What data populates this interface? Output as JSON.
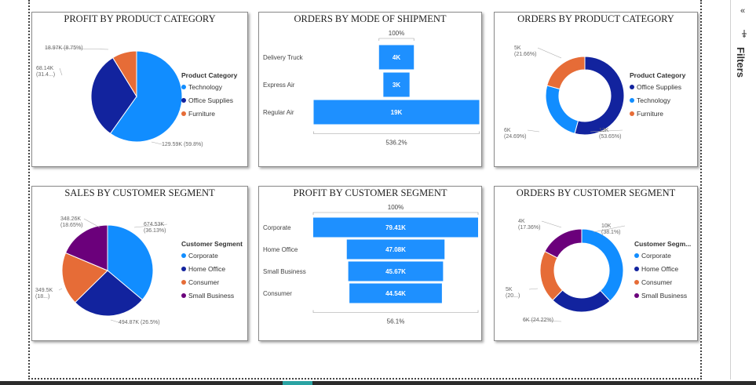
{
  "filters": {
    "label": "Filters",
    "chevron": "«"
  },
  "colors": {
    "light_blue": "#118DFF",
    "navy": "#12239E",
    "orange": "#E66C37",
    "purple": "#6B007B",
    "bar": "#1E90FF"
  },
  "chart_data": [
    {
      "type": "pie",
      "title": "PROFIT BY PRODUCT CATEGORY",
      "legend_title": "Product Category",
      "legend_position": "right",
      "slices": [
        {
          "name": "Technology",
          "value": 129.59,
          "label": "129.59K (59.8%)",
          "color": "#118DFF"
        },
        {
          "name": "Office Supplies",
          "value": 68.14,
          "label": "68.14K (31.4...)",
          "color": "#12239E"
        },
        {
          "name": "Furniture",
          "value": 18.97,
          "label": "18.97K (8.75%)",
          "color": "#E66C37"
        }
      ]
    },
    {
      "type": "bar",
      "subtype": "funnel",
      "title": "ORDERS BY MODE OF SHIPMENT",
      "top_label": "100%",
      "bottom_label": "536.2%",
      "categories": [
        "Delivery Truck",
        "Express Air",
        "Regular Air"
      ],
      "values": [
        4,
        3,
        19
      ],
      "value_labels": [
        "4K",
        "3K",
        "19K"
      ]
    },
    {
      "type": "pie",
      "subtype": "donut",
      "title": "ORDERS BY PRODUCT CATEGORY",
      "legend_title": "Product Category",
      "legend_position": "right",
      "slices": [
        {
          "name": "Office Supplies",
          "value": 13,
          "label": "13K (53.65%)",
          "color": "#12239E"
        },
        {
          "name": "Technology",
          "value": 6,
          "label": "6K (24.69%)",
          "color": "#118DFF"
        },
        {
          "name": "Furniture",
          "value": 5,
          "label": "5K (21.66%)",
          "color": "#E66C37"
        }
      ]
    },
    {
      "type": "pie",
      "title": "SALES BY CUSTOMER SEGMENT",
      "legend_title": "Customer Segment",
      "legend_position": "right",
      "slices": [
        {
          "name": "Corporate",
          "value": 674.53,
          "label": "674.53K (36.13%)",
          "color": "#118DFF"
        },
        {
          "name": "Home Office",
          "value": 494.87,
          "label": "494.87K (26.5%)",
          "color": "#12239E"
        },
        {
          "name": "Consumer",
          "value": 349.5,
          "label": "349.5K (18...)",
          "color": "#E66C37"
        },
        {
          "name": "Small Business",
          "value": 348.26,
          "label": "348.26K (18.65%)",
          "color": "#6B007B"
        }
      ]
    },
    {
      "type": "bar",
      "subtype": "funnel",
      "title": "PROFIT BY CUSTOMER SEGMENT",
      "top_label": "100%",
      "bottom_label": "56.1%",
      "categories": [
        "Corporate",
        "Home Office",
        "Small Business",
        "Consumer"
      ],
      "values": [
        79.41,
        47.08,
        45.67,
        44.54
      ],
      "value_labels": [
        "79.41K",
        "47.08K",
        "45.67K",
        "44.54K"
      ]
    },
    {
      "type": "pie",
      "subtype": "donut",
      "title": "ORDERS BY CUSTOMER SEGMENT",
      "legend_title": "Customer Segm...",
      "legend_position": "right",
      "slices": [
        {
          "name": "Corporate",
          "value": 38.1,
          "label": "10K (38.1%)",
          "color": "#118DFF"
        },
        {
          "name": "Home Office",
          "value": 24.22,
          "label": "6K (24.22%)",
          "color": "#12239E"
        },
        {
          "name": "Consumer",
          "value": 20.32,
          "label": "5K (20...)",
          "color": "#E66C37"
        },
        {
          "name": "Small Business",
          "value": 17.36,
          "label": "4K (17.36%)",
          "color": "#6B007B"
        }
      ]
    }
  ]
}
